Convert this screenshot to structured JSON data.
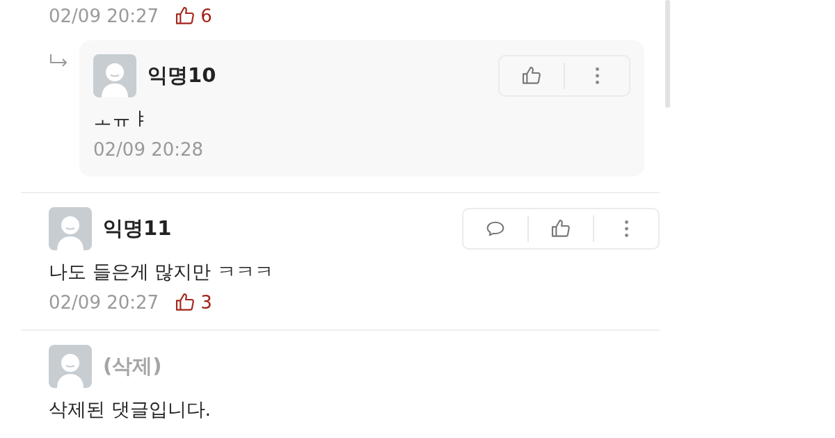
{
  "comments": [
    {
      "kind": "tail",
      "time": "02/09 20:27",
      "likes": "6"
    },
    {
      "kind": "reply",
      "deleted": false,
      "author": "익명10",
      "text": "ㅗㅠㅑ",
      "time": "02/09 20:28",
      "actions": [
        {
          "kind": "like"
        },
        {
          "kind": "more"
        }
      ]
    },
    {
      "kind": "comment",
      "deleted": false,
      "author": "익명11",
      "text": "나도 들은게 많지만 ㅋㅋㅋ",
      "time": "02/09 20:27",
      "likes": "3",
      "actions": [
        {
          "kind": "reply"
        },
        {
          "kind": "like"
        },
        {
          "kind": "more"
        }
      ]
    },
    {
      "kind": "comment",
      "deleted": true,
      "author": "(삭제)",
      "text": "삭제된 댓글입니다."
    }
  ]
}
